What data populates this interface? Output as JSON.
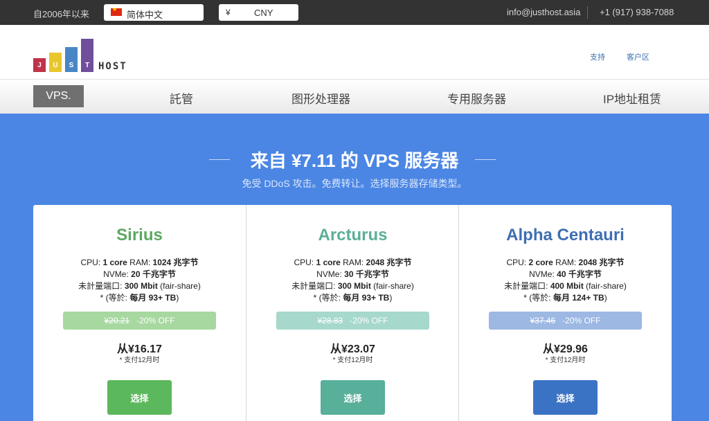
{
  "topbar": {
    "since": "自2006年以来",
    "language": "简体中文",
    "currency_symbol": "¥",
    "currency": "CNY",
    "email": "info@justhost.asia",
    "phone": "+1 (917) 938-7088"
  },
  "header": {
    "logo_letters": [
      "J",
      "U",
      "S",
      "T"
    ],
    "logo_colors": [
      "#c0334a",
      "#e8c72e",
      "#4a86c5",
      "#6f4e9b"
    ],
    "logo_host": "HOST",
    "links": [
      "支持",
      "客户区"
    ]
  },
  "nav": {
    "items": [
      "VPS.",
      "託管",
      "图形处理器",
      "专用服务器",
      "IP地址租赁"
    ]
  },
  "hero": {
    "title": "来自 ¥7.11 的 VPS 服务器",
    "subtitle": "免受 DDoS 攻击。免费转让。选择服务器存储类型。"
  },
  "plans": [
    {
      "name": "Sirius",
      "name_color": "#5aa860",
      "cpu_label": "CPU:",
      "cpu": "1 core",
      "ram_label": "RAM:",
      "ram": "1024 兆字节",
      "nvme_label": "NVMe:",
      "nvme": "20 千兆字节",
      "port_label": "未計量端口:",
      "port": "300 Mbit",
      "port_note": "(fair-share)",
      "traffic_prefix": "* (等於:",
      "traffic": "每月 93+ TB",
      "traffic_suffix": ")",
      "old_price": "¥20.21",
      "discount": "-20% OFF",
      "discount_color": "#a7d8a0",
      "price": "从¥16.17",
      "pay_note": "*  支付12月时",
      "button": "选择",
      "button_color": "#5cb85c"
    },
    {
      "name": "Arcturus",
      "name_color": "#5cae98",
      "cpu_label": "CPU:",
      "cpu": "1 core",
      "ram_label": "RAM:",
      "ram": "2048 兆字节",
      "nvme_label": "NVMe:",
      "nvme": "30 千兆字节",
      "port_label": "未計量端口:",
      "port": "300 Mbit",
      "port_note": "(fair-share)",
      "traffic_prefix": "* (等於:",
      "traffic": "每月 93+ TB",
      "traffic_suffix": ")",
      "old_price": "¥28.83",
      "discount": "-20% OFF",
      "discount_color": "#a6d8cc",
      "price": "从¥23.07",
      "pay_note": "*  支付12月时",
      "button": "选择",
      "button_color": "#58af9a"
    },
    {
      "name": "Alpha Centauri",
      "name_color": "#3e6fb3",
      "cpu_label": "CPU:",
      "cpu": "2 core",
      "ram_label": "RAM:",
      "ram": "2048 兆字节",
      "nvme_label": "NVMe:",
      "nvme": "40 千兆字节",
      "port_label": "未計量端口:",
      "port": "400 Mbit",
      "port_note": "(fair-share)",
      "traffic_prefix": "* (等於:",
      "traffic": "每月 124+ TB",
      "traffic_suffix": ")",
      "old_price": "¥37.46",
      "discount": "-20% OFF",
      "discount_color": "#9cb8e3",
      "price": "从¥29.96",
      "pay_note": "*  支付12月时",
      "button": "选择",
      "button_color": "#3b73c4"
    }
  ]
}
